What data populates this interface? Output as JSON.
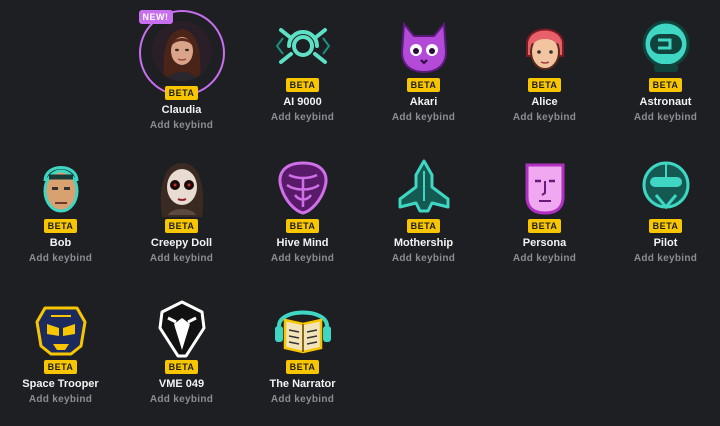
{
  "voices": [
    {
      "name": "Claudia",
      "badge": "BETA",
      "keybind": "Add keybind",
      "new_label": "NEW!",
      "icon": "claudia-portrait-icon",
      "color": "#b06a55",
      "selected": true
    },
    {
      "name": "AI 9000",
      "badge": "BETA",
      "keybind": "Add keybind",
      "icon": "ai9000-icon",
      "color": "#5ee0c6"
    },
    {
      "name": "Akari",
      "badge": "BETA",
      "keybind": "Add keybind",
      "icon": "cat-icon",
      "color": "#b44ad8"
    },
    {
      "name": "Alice",
      "badge": "BETA",
      "keybind": "Add keybind",
      "icon": "alice-face-icon",
      "color": "#e8606a"
    },
    {
      "name": "Astronaut",
      "badge": "BETA",
      "keybind": "Add keybind",
      "icon": "astronaut-helmet-icon",
      "color": "#3fd6c4"
    },
    {
      "name": "Bob",
      "badge": "BETA",
      "keybind": "Add keybind",
      "icon": "bob-face-icon",
      "color": "#3fd6c4"
    },
    {
      "name": "Creepy Doll",
      "badge": "BETA",
      "keybind": "Add keybind",
      "icon": "creepy-doll-portrait-icon",
      "color": "#8a6a5a"
    },
    {
      "name": "Hive Mind",
      "badge": "BETA",
      "keybind": "Add keybind",
      "icon": "hive-mind-icon",
      "color": "#b44ad8"
    },
    {
      "name": "Mothership",
      "badge": "BETA",
      "keybind": "Add keybind",
      "icon": "mothership-icon",
      "color": "#3fd6c4"
    },
    {
      "name": "Persona",
      "badge": "BETA",
      "keybind": "Add keybind",
      "icon": "persona-mask-icon",
      "color": "#d860e8"
    },
    {
      "name": "Pilot",
      "badge": "BETA",
      "keybind": "Add keybind",
      "icon": "pilot-helmet-icon",
      "color": "#3fd6c4"
    },
    {
      "name": "Space Trooper",
      "badge": "BETA",
      "keybind": "Add keybind",
      "icon": "space-trooper-icon",
      "color": "#f7c600"
    },
    {
      "name": "VME 049",
      "badge": "BETA",
      "keybind": "Add keybind",
      "icon": "plague-mask-icon",
      "color": "#ffffff"
    },
    {
      "name": "The Narrator",
      "badge": "BETA",
      "keybind": "Add keybind",
      "icon": "narrator-book-icon",
      "color": "#f7c600"
    }
  ],
  "colors": {
    "accent": "#c86ff0",
    "beta": "#f7c600",
    "background": "#1e1f22"
  }
}
